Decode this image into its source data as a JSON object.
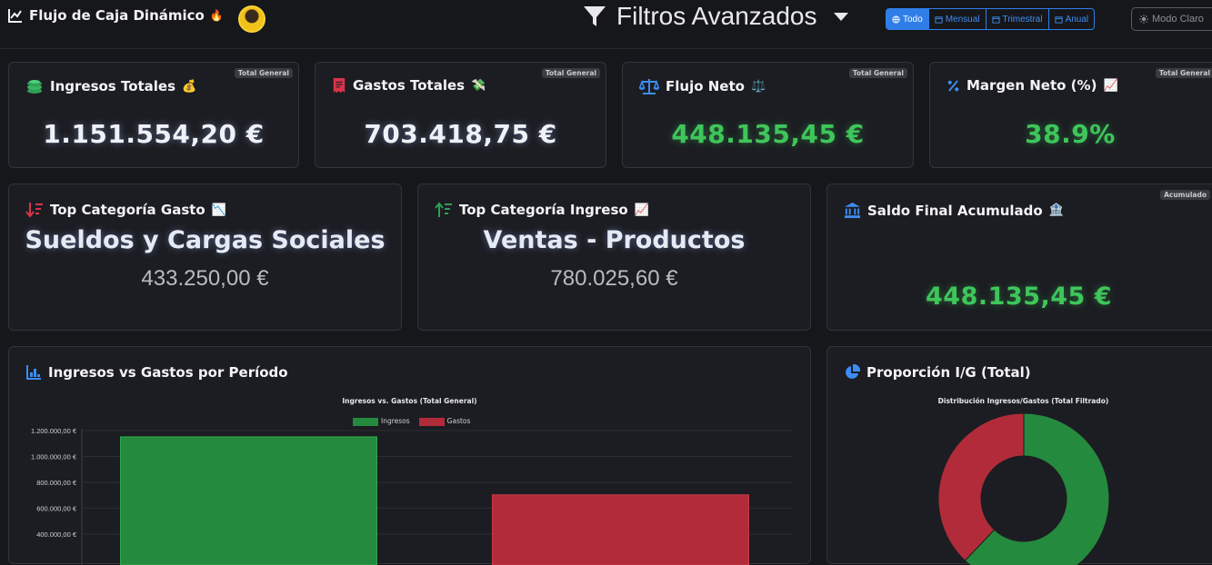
{
  "header": {
    "app_title": "Flujo de Caja Dinámico",
    "app_emoji": "🔥",
    "filters_title": "Filtros Avanzados",
    "periods": [
      {
        "label": "Todo",
        "active": true
      },
      {
        "label": "Mensual",
        "active": false
      },
      {
        "label": "Trimestral",
        "active": false
      },
      {
        "label": "Anual",
        "active": false
      }
    ],
    "mode_label": "Modo Claro"
  },
  "kpis": {
    "income": {
      "title": "Ingresos Totales",
      "emoji": "💰",
      "badge": "Total General",
      "value": "1.151.554,20 €"
    },
    "expense": {
      "title": "Gastos Totales",
      "emoji": "💸",
      "badge": "Total General",
      "value": "703.418,75 €"
    },
    "net": {
      "title": "Flujo Neto",
      "emoji": "⚖️",
      "badge": "Total General",
      "value": "448.135,45 €"
    },
    "margin": {
      "title": "Margen Neto (%)",
      "emoji": "📈",
      "badge": "Total General",
      "value": "38.9%"
    }
  },
  "top": {
    "expense": {
      "title": "Top Categoría Gasto",
      "emoji": "📉",
      "name": "Sueldos y Cargas Sociales",
      "value": "433.250,00 €"
    },
    "income": {
      "title": "Top Categoría Ingreso",
      "emoji": "📈",
      "name": "Ventas - Productos",
      "value": "780.025,60 €"
    },
    "balance": {
      "title": "Saldo Final Acumulado",
      "emoji": "🏦",
      "badge": "Acumulado",
      "value": "448.135,45 €"
    }
  },
  "bar_panel": {
    "title": "Ingresos vs Gastos por Período"
  },
  "pie_panel": {
    "title": "Proporción I/G (Total)"
  },
  "colors": {
    "income": "#248a3d",
    "expense": "#b22b3a",
    "accent": "#2f7ee8",
    "green": "#3ec65a"
  },
  "chart_data": [
    {
      "type": "bar",
      "title": "Ingresos vs. Gastos (Total General)",
      "series": [
        {
          "name": "Ingresos",
          "values": [
            1151554.2
          ]
        },
        {
          "name": "Gastos",
          "values": [
            703418.75
          ]
        }
      ],
      "yticks": [
        "1.200.000,00 €",
        "1.000.000,00 €",
        "800.000,00 €",
        "600.000,00 €",
        "400.000,00 €"
      ],
      "ylim": [
        0,
        1200000
      ],
      "legend": "top"
    },
    {
      "type": "pie",
      "title": "Distribución Ingresos/Gastos (Total Filtrado)",
      "labels": [
        "Ingresos",
        "Gastos"
      ],
      "values": [
        1151554.2,
        703418.75
      ]
    }
  ]
}
